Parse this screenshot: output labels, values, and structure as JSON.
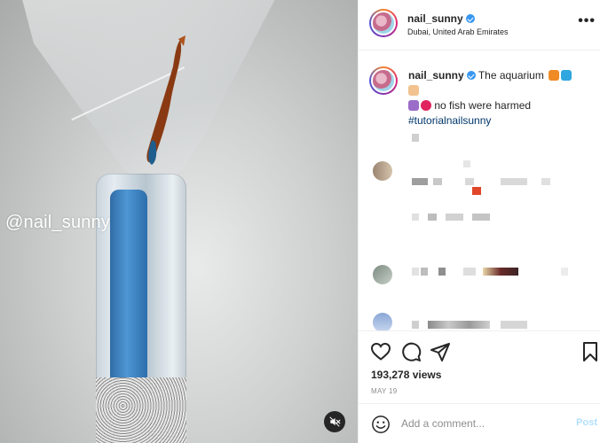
{
  "media": {
    "watermark": "@nail_sunny",
    "mute_icon": "speaker-muted-icon"
  },
  "header": {
    "username": "nail_sunny",
    "location": "Dubai, United Arab Emirates",
    "more_icon": "more-options-icon",
    "more_label": "•••"
  },
  "caption": {
    "username": "nail_sunny",
    "text_line1": "The aquarium",
    "text_line2": "no fish were harmed",
    "hashtag": "#tutorialnailsunny"
  },
  "actions": {
    "like_icon": "heart-icon",
    "comment_icon": "comment-icon",
    "share_icon": "paper-plane-icon",
    "save_icon": "bookmark-icon",
    "views": "193,278 views",
    "date": "MAY 19"
  },
  "add_comment": {
    "emoji_icon": "smiley-icon",
    "placeholder": "Add a comment...",
    "post_label": "Post"
  },
  "colors": {
    "verified": "#3897f0",
    "link": "#00376b",
    "post_disabled": "#b2dffc",
    "muted_text": "#8e8e8e"
  }
}
